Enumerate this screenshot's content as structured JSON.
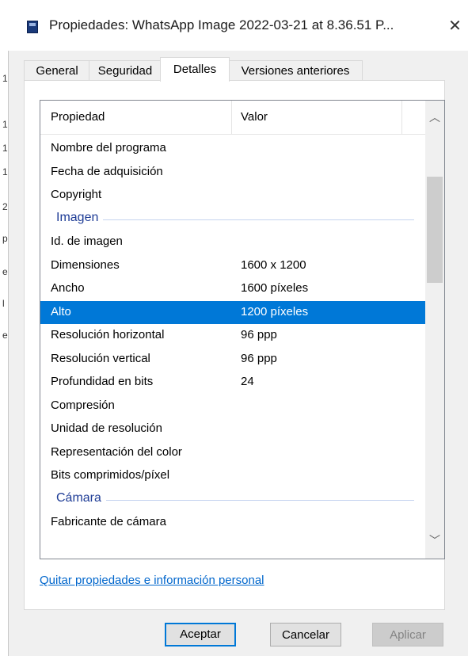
{
  "window": {
    "title": "Propiedades: WhatsApp Image 2022-03-21 at 8.36.51 P...",
    "close_glyph": "✕",
    "icon": "image-file-icon"
  },
  "tabs": [
    {
      "label": "General",
      "active": false
    },
    {
      "label": "Seguridad",
      "active": false
    },
    {
      "label": "Detalles",
      "active": true
    },
    {
      "label": "Versiones anteriores",
      "active": false
    }
  ],
  "list": {
    "headers": {
      "property": "Propiedad",
      "value": "Valor"
    },
    "rows": [
      {
        "type": "row",
        "property": "Nombre del programa",
        "value": ""
      },
      {
        "type": "row",
        "property": "Fecha de adquisición",
        "value": ""
      },
      {
        "type": "row",
        "property": "Copyright",
        "value": ""
      },
      {
        "type": "group",
        "label": "Imagen"
      },
      {
        "type": "row",
        "property": "Id. de imagen",
        "value": ""
      },
      {
        "type": "row",
        "property": "Dimensiones",
        "value": "1600 x 1200"
      },
      {
        "type": "row",
        "property": "Ancho",
        "value": "1600 píxeles"
      },
      {
        "type": "row",
        "property": "Alto",
        "value": "1200 píxeles",
        "selected": true
      },
      {
        "type": "row",
        "property": "Resolución horizontal",
        "value": "96 ppp"
      },
      {
        "type": "row",
        "property": "Resolución vertical",
        "value": "96 ppp"
      },
      {
        "type": "row",
        "property": "Profundidad en bits",
        "value": "24"
      },
      {
        "type": "row",
        "property": "Compresión",
        "value": ""
      },
      {
        "type": "row",
        "property": "Unidad de resolución",
        "value": ""
      },
      {
        "type": "row",
        "property": "Representación del color",
        "value": ""
      },
      {
        "type": "row",
        "property": "Bits comprimidos/píxel",
        "value": ""
      },
      {
        "type": "group",
        "label": "Cámara"
      },
      {
        "type": "row",
        "property": "Fabricante de cámara",
        "value": ""
      }
    ],
    "scroll_up_glyph": "︿",
    "scroll_down_glyph": "﹀"
  },
  "remove_link": "Quitar propiedades e información personal",
  "buttons": {
    "ok": "Aceptar",
    "cancel": "Cancelar",
    "apply": "Aplicar"
  }
}
